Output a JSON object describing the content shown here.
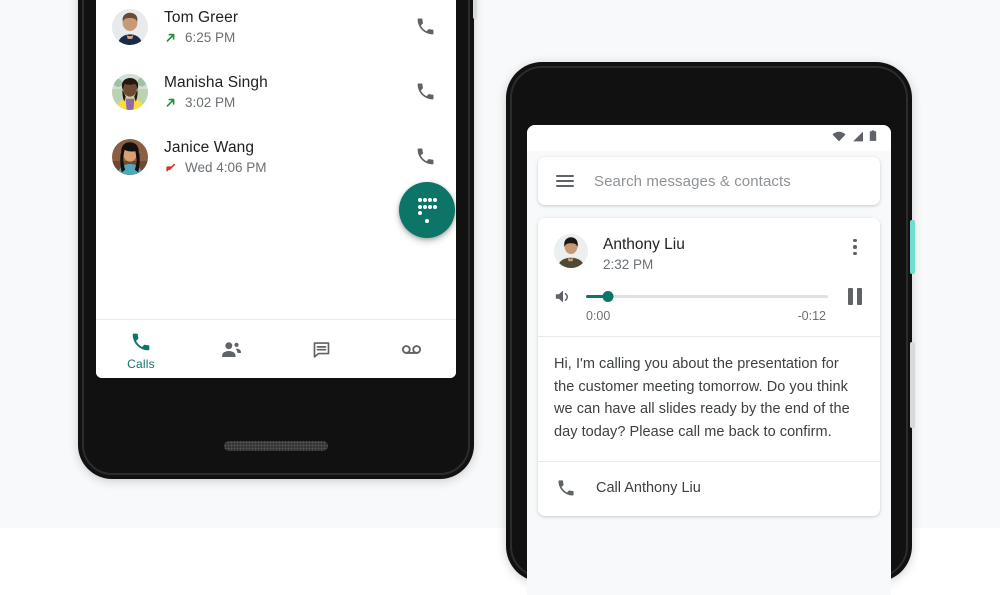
{
  "theme": {
    "accent_teal": "#0d7468",
    "outgoing_green": "#1e8e3e",
    "missed_red": "#d93025",
    "page_background": "#f7f9fa",
    "text_primary": "#202124",
    "text_secondary": "#6b7074",
    "power_button_mint": "#6fded0"
  },
  "left_phone": {
    "app": "Phone",
    "search_stub": {
      "label": ""
    },
    "call_log": {
      "rows": [
        {
          "name": "Tom Greer",
          "time": "6:25 PM",
          "direction": "outgoing",
          "direction_icon": "arrow-outgoing-icon",
          "action_icon": "call-icon"
        },
        {
          "name": "Manisha Singh",
          "time": "3:02 PM",
          "direction": "outgoing",
          "direction_icon": "arrow-outgoing-icon",
          "action_icon": "call-icon"
        },
        {
          "name": "Janice Wang",
          "time": "Wed 4:06 PM",
          "direction": "missed",
          "direction_icon": "arrow-missed-icon",
          "action_icon": "call-icon"
        }
      ]
    },
    "fab": {
      "icon": "dialpad-icon",
      "label": ""
    },
    "bottom_nav": {
      "items": [
        {
          "label": "Calls",
          "icon": "call-icon",
          "active": true
        },
        {
          "label": "",
          "icon": "contacts-icon",
          "active": false
        },
        {
          "label": "",
          "icon": "messages-icon",
          "active": false
        },
        {
          "label": "",
          "icon": "voicemail-icon",
          "active": false
        }
      ]
    }
  },
  "right_phone": {
    "status_bar": {
      "icons": [
        "wifi-icon",
        "signal-icon",
        "battery-icon"
      ]
    },
    "search": {
      "menu_icon": "hamburger-menu-icon",
      "placeholder": "Search messages & contacts"
    },
    "voicemail_card": {
      "name": "Anthony Liu",
      "time": "2:32 PM",
      "overflow_icon": "more-vert-icon",
      "player": {
        "volume_icon": "volume-up-icon",
        "transport_icon": "pause-icon",
        "progress_percent": 9,
        "elapsed": "0:00",
        "remaining": "-0:12"
      },
      "transcript": "Hi, I'm calling you about the presentation for the customer meeting tomorrow. Do you think we can have all slides ready by the end of the day today? Please call me back to confirm.",
      "action": {
        "icon": "call-icon",
        "label": "Call Anthony Liu"
      }
    }
  }
}
